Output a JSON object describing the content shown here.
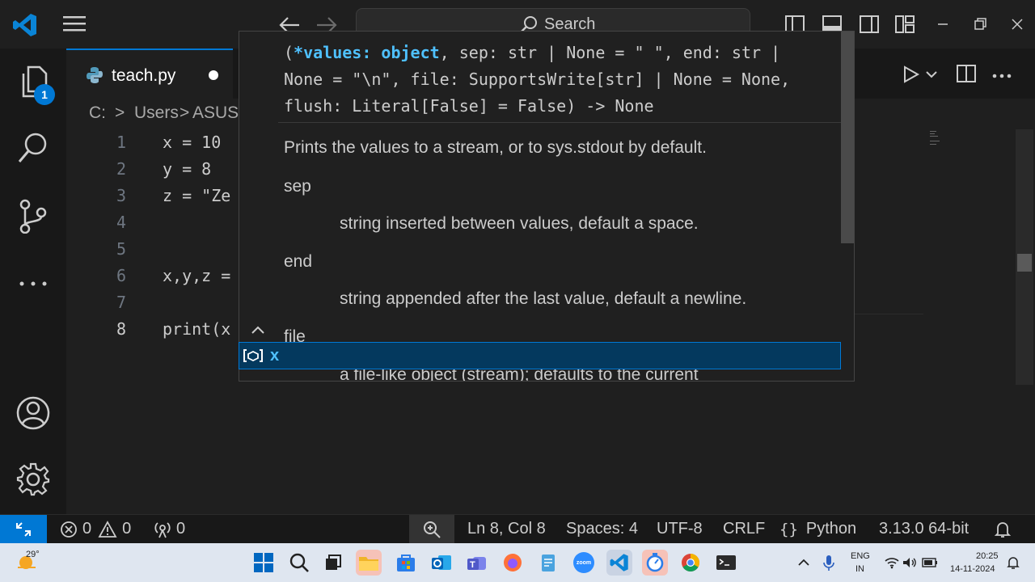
{
  "titlebar": {
    "search_label": "Search"
  },
  "activity": {
    "explorer_badge": "1"
  },
  "tab": {
    "filename": "teach.py"
  },
  "breadcrumb": {
    "drive": "C:",
    "sep1": ">",
    "users": "Users",
    "sep2": ">",
    "user": "ASUS"
  },
  "editor": {
    "lines": [
      {
        "num": "1",
        "code": "x = 10"
      },
      {
        "num": "2",
        "code": "y = 8"
      },
      {
        "num": "3",
        "code": "z = \"Ze"
      },
      {
        "num": "4",
        "code": ""
      },
      {
        "num": "5",
        "code": ""
      },
      {
        "num": "6",
        "code": "x,y,z ="
      },
      {
        "num": "7",
        "code": ""
      },
      {
        "num": "8",
        "code": "print(x"
      }
    ]
  },
  "hover": {
    "sig_open": "(",
    "sig_param": "*values: object",
    "sig_rest1": ", sep: str | None = \" \", end: str |",
    "sig_line2": "None = \"\\n\", file: SupportsWrite[str] | None = None,",
    "sig_line3": "flush: Literal[False] = False) -> None",
    "description": "Prints the values to a stream, or to sys.stdout by default.",
    "sep_name": "sep",
    "sep_desc": "string inserted between values, default a space.",
    "end_name": "end",
    "end_desc": "string appended after the last value, default a newline.",
    "file_name": "file",
    "file_desc": "a file-like object (stream); defaults to the current"
  },
  "suggest": {
    "item": "x"
  },
  "statusbar": {
    "errors": "0",
    "warnings": "0",
    "ports": "0",
    "position": "Ln 8, Col 8",
    "spaces": "Spaces: 4",
    "encoding": "UTF-8",
    "eol": "CRLF",
    "language": "Python",
    "interpreter": "3.13.0 64-bit"
  },
  "taskbar": {
    "weather": "29°",
    "lang_top": "ENG",
    "lang_bottom": "IN",
    "time": "20:25",
    "date": "14-11-2024",
    "zoom_label": "zoom"
  },
  "colors": {
    "accent": "#0078d4",
    "keyword_blue": "#4fc1ff",
    "status_remote": "#0078d4"
  }
}
